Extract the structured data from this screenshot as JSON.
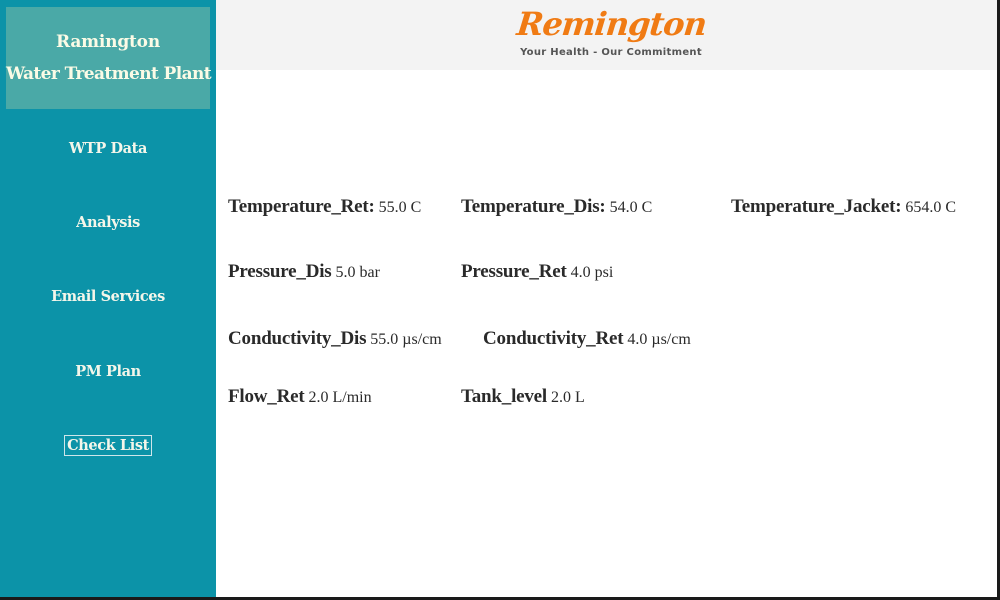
{
  "sidebar": {
    "brand_line1": "Ramington",
    "brand_line2": "Water Treatment Plant",
    "items": [
      {
        "label": "WTP Data"
      },
      {
        "label": "Analysis"
      },
      {
        "label": "Email Services"
      },
      {
        "label": "PM Plan"
      },
      {
        "label": "Check List"
      }
    ]
  },
  "header": {
    "logo_text": "Remington",
    "tagline": "Your Health - Our Commitment"
  },
  "readings": {
    "temperature_ret": {
      "label": "Temperature_Ret:",
      "value": "55.0 C"
    },
    "temperature_dis": {
      "label": "Temperature_Dis:",
      "value": "54.0 C"
    },
    "temperature_jacket": {
      "label": "Temperature_Jacket:",
      "value": "654.0 C"
    },
    "pressure_dis": {
      "label": "Pressure_Dis",
      "value": "5.0 bar"
    },
    "pressure_ret": {
      "label": "Pressure_Ret",
      "value": "4.0 psi"
    },
    "conductivity_dis": {
      "label": "Conductivity_Dis",
      "value": "55.0 µs/cm"
    },
    "conductivity_ret": {
      "label": "Conductivity_Ret",
      "value": " 4.0 µs/cm"
    },
    "flow_ret": {
      "label": "Flow_Ret",
      "value": "2.0 L/min"
    },
    "tank_level": {
      "label": "Tank_level",
      "value": "2.0 L"
    }
  },
  "colors": {
    "sidebar_bg": "#0c93a8",
    "brand_box_bg": "#4aa9a7",
    "logo_orange": "#f07b14",
    "header_bg": "#f3f3f3"
  }
}
